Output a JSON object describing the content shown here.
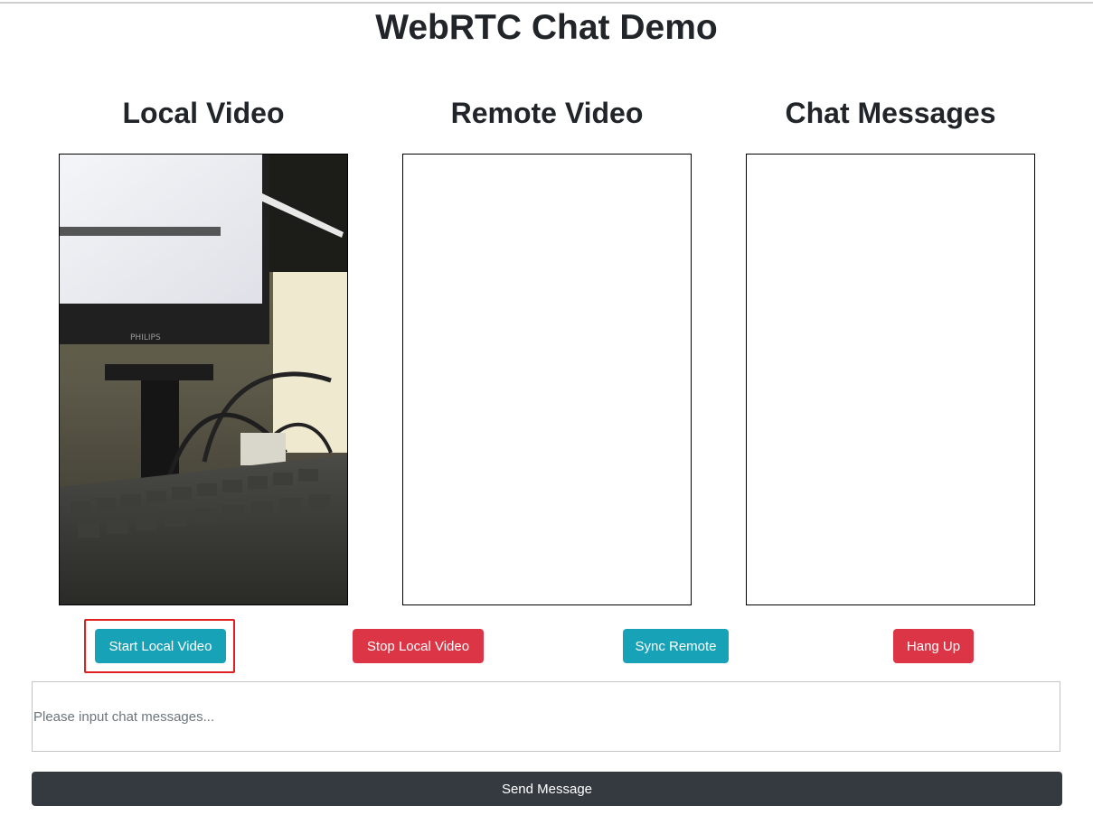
{
  "page": {
    "title": "WebRTC Chat Demo"
  },
  "sections": {
    "local_video": "Local Video",
    "remote_video": "Remote Video",
    "chat_messages": "Chat Messages"
  },
  "controls": {
    "start_local_video": "Start Local Video",
    "stop_local_video": "Stop Local Video",
    "sync_remote": "Sync Remote",
    "hang_up": "Hang Up"
  },
  "chat_input": {
    "value": "",
    "placeholder": "Please input chat messages..."
  },
  "send_button": "Send Message",
  "colors": {
    "info": "#17a2b8",
    "danger": "#dc3545",
    "dark": "#343a40",
    "highlight": "#e02020"
  }
}
